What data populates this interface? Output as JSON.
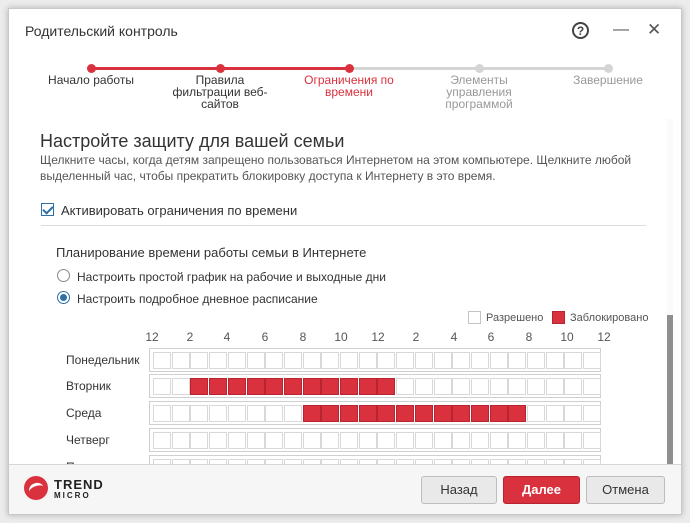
{
  "window": {
    "title": "Родительский контроль"
  },
  "titlebar": {
    "help_glyph": "?",
    "minimize_glyph": "—",
    "close_glyph": "✕"
  },
  "wizard": {
    "steps": [
      {
        "label": "Начало работы",
        "state": "done"
      },
      {
        "label": "Правила фильтрации веб-сайтов",
        "state": "done"
      },
      {
        "label": "Ограничения по времени",
        "state": "current"
      },
      {
        "label": "Элементы управления программой",
        "state": "pending"
      },
      {
        "label": "Завершение",
        "state": "pending"
      }
    ]
  },
  "content": {
    "heading": "Настройте защиту для вашей семьи",
    "description": "Щелкните часы, когда детям запрещено пользоваться Интернетом на этом компьютере. Щелкните любой выделенный час, чтобы прекратить блокировку доступа к Интернету в это время.",
    "enable_checkbox": {
      "label": "Активировать ограничения по времени",
      "checked": true
    },
    "schedule_title": "Планирование времени работы семьи в Интернете",
    "radio_simple": {
      "label": "Настроить простой график на рабочие и выходные дни",
      "selected": false
    },
    "radio_detailed": {
      "label": "Настроить подробное дневное расписание",
      "selected": true
    },
    "legend": {
      "allowed": "Разрешено",
      "blocked": "Заблокировано"
    },
    "hour_labels": [
      "12",
      "2",
      "4",
      "6",
      "8",
      "10",
      "12",
      "2",
      "4",
      "6",
      "8",
      "10",
      "12"
    ],
    "days": [
      {
        "name": "Понедельник",
        "blocked_hours": []
      },
      {
        "name": "Вторник",
        "blocked_hours": [
          2,
          3,
          4,
          5,
          6,
          7,
          8,
          9,
          10,
          11,
          12
        ]
      },
      {
        "name": "Среда",
        "blocked_hours": [
          8,
          9,
          10,
          11,
          12,
          13,
          14,
          15,
          16,
          17,
          18,
          19
        ]
      },
      {
        "name": "Четверг",
        "blocked_hours": []
      },
      {
        "name": "Пятница",
        "blocked_hours": []
      }
    ]
  },
  "footer": {
    "logo_line1": "TREND",
    "logo_line2": "MICRO",
    "back_label": "Назад",
    "next_label": "Далее",
    "cancel_label": "Отмена"
  },
  "colors": {
    "accent_red": "#d9313d",
    "pending_gray": "#d5d5d5",
    "radio_blue": "#2e6fa7"
  }
}
